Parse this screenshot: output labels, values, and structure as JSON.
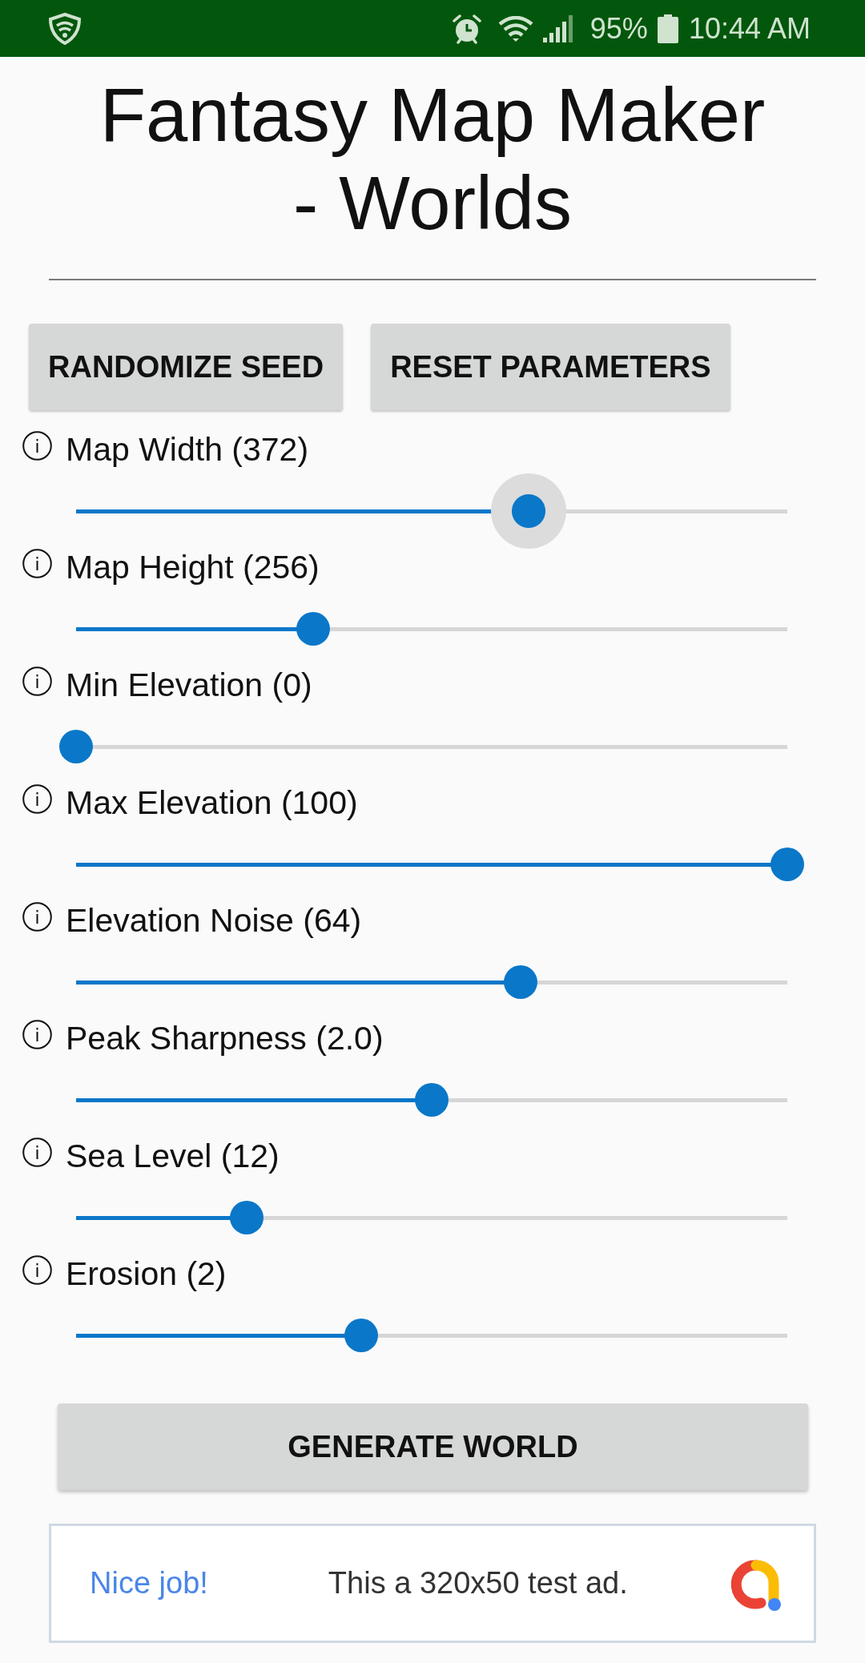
{
  "status_bar": {
    "battery": "95%",
    "time": "10:44 AM"
  },
  "title": "Fantasy Map Maker - Worlds",
  "buttons": [
    {
      "label": "RANDOMIZE SEED"
    },
    {
      "label": "RESET PARAMETERS"
    }
  ],
  "parameters": [
    {
      "label": "Map Width (372)",
      "level": 0.636,
      "focused": true
    },
    {
      "label": "Map Height (256)",
      "level": 0.333,
      "focused": false
    },
    {
      "label": "Min Elevation (0)",
      "level": 0,
      "focused": false
    },
    {
      "label": "Max Elevation (100)",
      "level": 1,
      "focused": false
    },
    {
      "label": "Elevation Noise (64)",
      "level": 0.625,
      "focused": false
    },
    {
      "label": "Peak Sharpness (2.0)",
      "level": 0.5,
      "focused": false
    },
    {
      "label": "Sea Level (12)",
      "level": 0.24,
      "focused": false
    },
    {
      "label": "Erosion (2)",
      "level": 0.401,
      "focused": false
    }
  ],
  "generate_button": "GENERATE WORLD",
  "ad": {
    "headline": "Nice job!",
    "text": "This a 320x50 test ad."
  }
}
